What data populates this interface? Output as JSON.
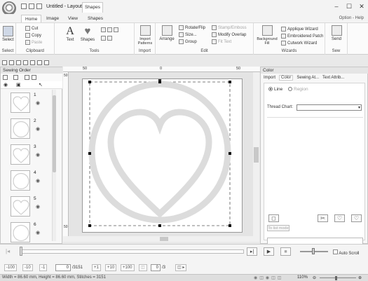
{
  "window": {
    "title": "Untitled - Layout & Editing",
    "context_tab": "Shapes",
    "controls": {
      "minimize": "–",
      "maximize": "☐",
      "close": "✕"
    }
  },
  "tabs": [
    {
      "label": "Home",
      "active": true
    },
    {
      "label": "Image",
      "active": false
    },
    {
      "label": "View",
      "active": false
    },
    {
      "label": "Shapes",
      "active": false
    }
  ],
  "help_links": "Option - Help",
  "ribbon": {
    "select": {
      "label": "Select",
      "group": "Select"
    },
    "clipboard": {
      "cut": "Cut",
      "copy": "Copy",
      "paste": "Paste",
      "group": "Clipboard"
    },
    "tools": {
      "text": "Text",
      "shapes": "Shapes",
      "group": "Tools"
    },
    "import": {
      "label": "Import Patterns",
      "group": "Import"
    },
    "edit": {
      "arrange": "Arrange",
      "rotate_flip": "Rotate/Flip",
      "size": "Size...",
      "group_btn": "Group",
      "stamp_emboss": "Stamp/Emboss",
      "modify_overlap": "Modify Overlap",
      "fit_text": "Fit Text",
      "group": "Edit"
    },
    "wizards": {
      "background_fill": "Background Fill",
      "applique": "Applique Wizard",
      "embroidered_patch": "Embroidered Patch",
      "cutwork": "Cutwork Wizard",
      "group": "Wizards"
    },
    "sew": {
      "send": "Send",
      "group": "Sew"
    }
  },
  "sewing_order": {
    "title": "Sewing Order",
    "items": [
      {
        "num": "1",
        "shape": "heart"
      },
      {
        "num": "2",
        "shape": "circle"
      },
      {
        "num": "3",
        "shape": "heart"
      },
      {
        "num": "4",
        "shape": "circle"
      },
      {
        "num": "5",
        "shape": "heart"
      },
      {
        "num": "6",
        "shape": "circle"
      }
    ]
  },
  "rulers": {
    "top_labels": [
      "50",
      "0",
      "50"
    ],
    "left_labels": [
      "50",
      "50"
    ]
  },
  "color_panel": {
    "title": "Color",
    "tabs": [
      "Import",
      "Color",
      "Sewing At...",
      "Text Attrib..."
    ],
    "line_label": "Line",
    "region_label": "Region",
    "thread_chart_label": "Thread Chart:",
    "thread_chart_value": "",
    "to_list_mode": "To list mode"
  },
  "step": {
    "buttons": [
      "-100",
      "-10",
      "-1",
      "+1",
      "+10",
      "+100"
    ],
    "stitch_value": "0",
    "stitch_total": "/3151",
    "color_value": "0",
    "color_total": "/3",
    "auto_scroll": "Auto Scroll"
  },
  "status": {
    "text": "Width = 86.60 mm, Height = 86.60 mm, Stitches = 3151",
    "zoom": "110%"
  }
}
